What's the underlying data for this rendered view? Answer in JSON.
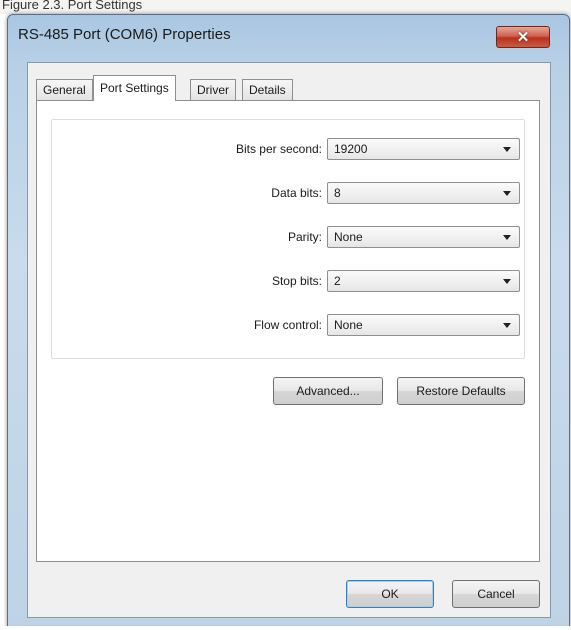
{
  "window": {
    "title": "RS-485 Port (COM6) Properties",
    "caption_fragment": "Figure 2.3. Port Settings",
    "close_label": "✕"
  },
  "tabs": [
    {
      "label": "General",
      "active": false
    },
    {
      "label": "Port Settings",
      "active": true
    },
    {
      "label": "Driver",
      "active": false
    },
    {
      "label": "Details",
      "active": false
    }
  ],
  "settings": [
    {
      "label": "Bits per second:",
      "value": "19200"
    },
    {
      "label": "Data bits:",
      "value": "8"
    },
    {
      "label": "Parity:",
      "value": "None"
    },
    {
      "label": "Stop bits:",
      "value": "2"
    },
    {
      "label": "Flow control:",
      "value": "None"
    }
  ],
  "buttons": {
    "advanced": "Advanced...",
    "restore_defaults": "Restore Defaults",
    "ok": "OK",
    "cancel": "Cancel"
  },
  "colors": {
    "frame": "#b8d0e6",
    "close_button": "#c7442c",
    "client_bg": "#f0f0f0"
  }
}
